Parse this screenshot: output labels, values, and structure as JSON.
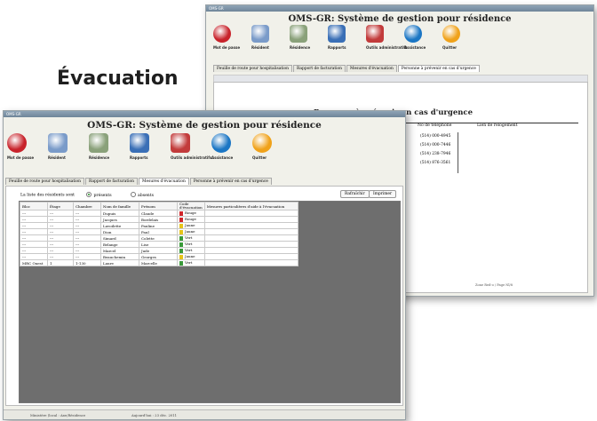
{
  "caption": "Évacuation",
  "app_title": "OMS-GR: Système de gestion pour résidence",
  "toolbar": [
    {
      "label": "Mot de passe",
      "icon": "lock-icon",
      "color": "#c8232b"
    },
    {
      "label": "Résident",
      "icon": "people-icon",
      "color": "#7a9bc9"
    },
    {
      "label": "Résidence",
      "icon": "building-icon",
      "color": "#8aa17a"
    },
    {
      "label": "Rapports",
      "icon": "report-icon",
      "color": "#3a6fb6"
    },
    {
      "label": "Outils administratifs",
      "icon": "tools-icon",
      "color": "#c23b3b"
    },
    {
      "label": "Assistance",
      "icon": "help-icon",
      "color": "#1b76c4"
    },
    {
      "label": "Quitter",
      "icon": "exit-icon",
      "color": "#f0a21a"
    }
  ],
  "tabs": [
    "Feuille de route pour hospitalisation",
    "Rapport de facturation",
    "Mesures d'évacuation",
    "Personne à prévenir en cas d'urgence"
  ],
  "back": {
    "doc_title": "Personne à prévenir en cas d'urgence",
    "headers": [
      "No de téléphone",
      "Lien de relogement"
    ],
    "phones": [
      "(514) 000-4945",
      "(514) 000-7446",
      "(514) 238-7946",
      "(514) 876-3561"
    ],
    "footer": "Zone Red-o / Page Nl/8"
  },
  "front": {
    "filter_label": "La liste des résidents sont",
    "radio_present": "présents",
    "radio_absent": "absents",
    "refresh_label": "Rafraîchir",
    "print_label": "Imprimer",
    "columns": [
      "Bloc",
      "Étage",
      "Chambre",
      "Nom de famille",
      "Prénom",
      "Code d'évacuation",
      "Mesures particulières d'aide à l'évacuation"
    ],
    "rows": [
      {
        "bloc": "---",
        "etage": "---",
        "chambre": "---",
        "nom": "Dupuis",
        "prenom": "Claude",
        "code": "Rouge",
        "color": "#d0262b"
      },
      {
        "bloc": "---",
        "etage": "---",
        "chambre": "---",
        "nom": "Jacques",
        "prenom": "Bordelais",
        "code": "Rouge",
        "color": "#d0262b"
      },
      {
        "bloc": "---",
        "etage": "---",
        "chambre": "---",
        "nom": "Lavoilette",
        "prenom": "Pauline",
        "code": "Jaune",
        "color": "#e6c41a"
      },
      {
        "bloc": "---",
        "etage": "---",
        "chambre": "---",
        "nom": "Dion",
        "prenom": "Paul",
        "code": "Jaune",
        "color": "#e6c41a"
      },
      {
        "bloc": "---",
        "etage": "---",
        "chambre": "---",
        "nom": "Simard",
        "prenom": "Colette",
        "code": "Vert",
        "color": "#3a9a3a"
      },
      {
        "bloc": "---",
        "etage": "---",
        "chambre": "---",
        "nom": "Belange",
        "prenom": "Lise",
        "code": "Vert",
        "color": "#3a9a3a"
      },
      {
        "bloc": "---",
        "etage": "---",
        "chambre": "---",
        "nom": "Marcel",
        "prenom": "Jude",
        "code": "Vert",
        "color": "#3a9a3a"
      },
      {
        "bloc": "---",
        "etage": "---",
        "chambre": "---",
        "nom": "Beauchemin",
        "prenom": "Georges",
        "code": "Jaune",
        "color": "#e6c41a"
      },
      {
        "bloc": "MRC Ouest",
        "etage": "1",
        "chambre": "1-130",
        "nom": "Laure",
        "prenom": "Marcelle",
        "code": "Vert",
        "color": "#3a9a3a"
      }
    ],
    "status_left": "Ministère (local : Axe/Résidence",
    "status_mid": "Aujourd'hui : 23 déc. 2011"
  }
}
